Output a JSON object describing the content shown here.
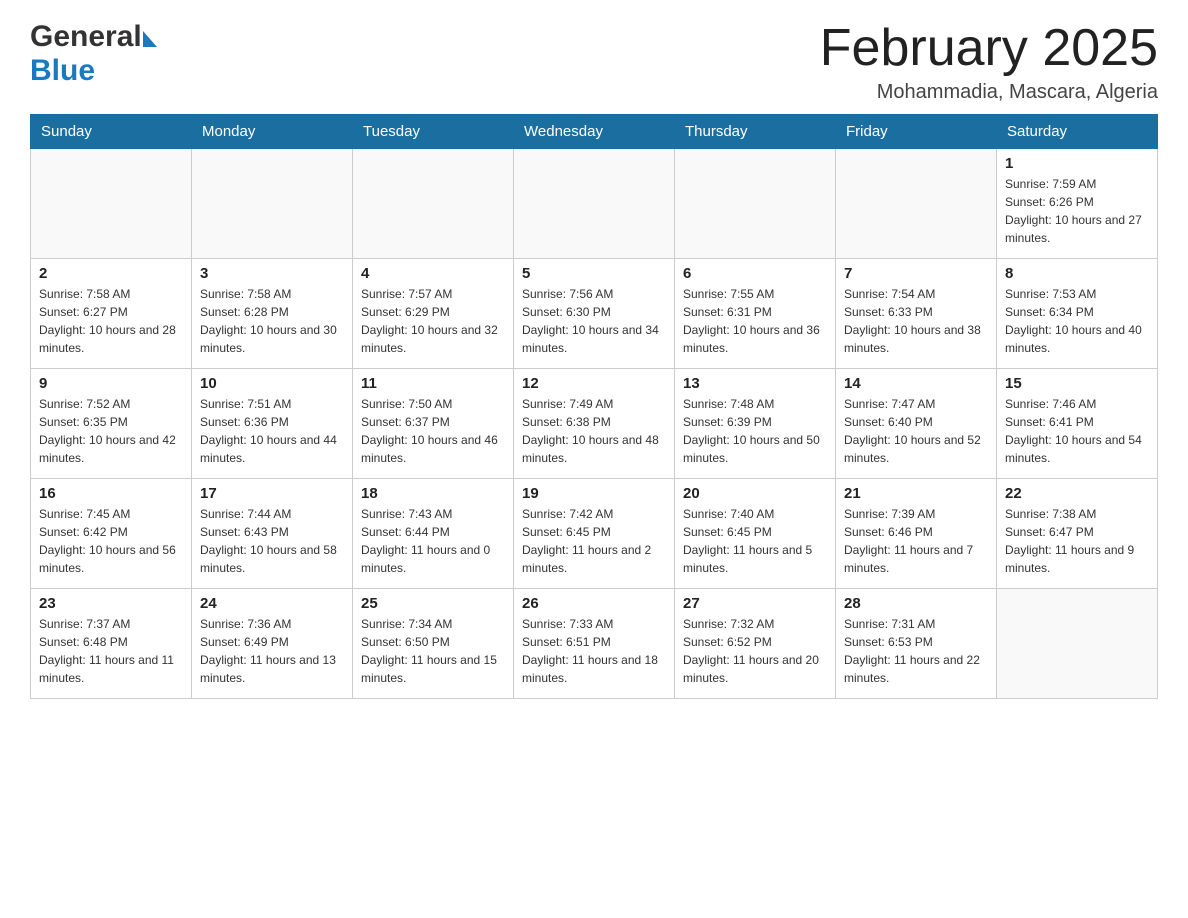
{
  "header": {
    "month_title": "February 2025",
    "location": "Mohammadia, Mascara, Algeria",
    "logo_general": "General",
    "logo_blue": "Blue"
  },
  "days_of_week": [
    "Sunday",
    "Monday",
    "Tuesday",
    "Wednesday",
    "Thursday",
    "Friday",
    "Saturday"
  ],
  "weeks": [
    [
      {
        "day": "",
        "sunrise": "",
        "sunset": "",
        "daylight": ""
      },
      {
        "day": "",
        "sunrise": "",
        "sunset": "",
        "daylight": ""
      },
      {
        "day": "",
        "sunrise": "",
        "sunset": "",
        "daylight": ""
      },
      {
        "day": "",
        "sunrise": "",
        "sunset": "",
        "daylight": ""
      },
      {
        "day": "",
        "sunrise": "",
        "sunset": "",
        "daylight": ""
      },
      {
        "day": "",
        "sunrise": "",
        "sunset": "",
        "daylight": ""
      },
      {
        "day": "1",
        "sunrise": "Sunrise: 7:59 AM",
        "sunset": "Sunset: 6:26 PM",
        "daylight": "Daylight: 10 hours and 27 minutes."
      }
    ],
    [
      {
        "day": "2",
        "sunrise": "Sunrise: 7:58 AM",
        "sunset": "Sunset: 6:27 PM",
        "daylight": "Daylight: 10 hours and 28 minutes."
      },
      {
        "day": "3",
        "sunrise": "Sunrise: 7:58 AM",
        "sunset": "Sunset: 6:28 PM",
        "daylight": "Daylight: 10 hours and 30 minutes."
      },
      {
        "day": "4",
        "sunrise": "Sunrise: 7:57 AM",
        "sunset": "Sunset: 6:29 PM",
        "daylight": "Daylight: 10 hours and 32 minutes."
      },
      {
        "day": "5",
        "sunrise": "Sunrise: 7:56 AM",
        "sunset": "Sunset: 6:30 PM",
        "daylight": "Daylight: 10 hours and 34 minutes."
      },
      {
        "day": "6",
        "sunrise": "Sunrise: 7:55 AM",
        "sunset": "Sunset: 6:31 PM",
        "daylight": "Daylight: 10 hours and 36 minutes."
      },
      {
        "day": "7",
        "sunrise": "Sunrise: 7:54 AM",
        "sunset": "Sunset: 6:33 PM",
        "daylight": "Daylight: 10 hours and 38 minutes."
      },
      {
        "day": "8",
        "sunrise": "Sunrise: 7:53 AM",
        "sunset": "Sunset: 6:34 PM",
        "daylight": "Daylight: 10 hours and 40 minutes."
      }
    ],
    [
      {
        "day": "9",
        "sunrise": "Sunrise: 7:52 AM",
        "sunset": "Sunset: 6:35 PM",
        "daylight": "Daylight: 10 hours and 42 minutes."
      },
      {
        "day": "10",
        "sunrise": "Sunrise: 7:51 AM",
        "sunset": "Sunset: 6:36 PM",
        "daylight": "Daylight: 10 hours and 44 minutes."
      },
      {
        "day": "11",
        "sunrise": "Sunrise: 7:50 AM",
        "sunset": "Sunset: 6:37 PM",
        "daylight": "Daylight: 10 hours and 46 minutes."
      },
      {
        "day": "12",
        "sunrise": "Sunrise: 7:49 AM",
        "sunset": "Sunset: 6:38 PM",
        "daylight": "Daylight: 10 hours and 48 minutes."
      },
      {
        "day": "13",
        "sunrise": "Sunrise: 7:48 AM",
        "sunset": "Sunset: 6:39 PM",
        "daylight": "Daylight: 10 hours and 50 minutes."
      },
      {
        "day": "14",
        "sunrise": "Sunrise: 7:47 AM",
        "sunset": "Sunset: 6:40 PM",
        "daylight": "Daylight: 10 hours and 52 minutes."
      },
      {
        "day": "15",
        "sunrise": "Sunrise: 7:46 AM",
        "sunset": "Sunset: 6:41 PM",
        "daylight": "Daylight: 10 hours and 54 minutes."
      }
    ],
    [
      {
        "day": "16",
        "sunrise": "Sunrise: 7:45 AM",
        "sunset": "Sunset: 6:42 PM",
        "daylight": "Daylight: 10 hours and 56 minutes."
      },
      {
        "day": "17",
        "sunrise": "Sunrise: 7:44 AM",
        "sunset": "Sunset: 6:43 PM",
        "daylight": "Daylight: 10 hours and 58 minutes."
      },
      {
        "day": "18",
        "sunrise": "Sunrise: 7:43 AM",
        "sunset": "Sunset: 6:44 PM",
        "daylight": "Daylight: 11 hours and 0 minutes."
      },
      {
        "day": "19",
        "sunrise": "Sunrise: 7:42 AM",
        "sunset": "Sunset: 6:45 PM",
        "daylight": "Daylight: 11 hours and 2 minutes."
      },
      {
        "day": "20",
        "sunrise": "Sunrise: 7:40 AM",
        "sunset": "Sunset: 6:45 PM",
        "daylight": "Daylight: 11 hours and 5 minutes."
      },
      {
        "day": "21",
        "sunrise": "Sunrise: 7:39 AM",
        "sunset": "Sunset: 6:46 PM",
        "daylight": "Daylight: 11 hours and 7 minutes."
      },
      {
        "day": "22",
        "sunrise": "Sunrise: 7:38 AM",
        "sunset": "Sunset: 6:47 PM",
        "daylight": "Daylight: 11 hours and 9 minutes."
      }
    ],
    [
      {
        "day": "23",
        "sunrise": "Sunrise: 7:37 AM",
        "sunset": "Sunset: 6:48 PM",
        "daylight": "Daylight: 11 hours and 11 minutes."
      },
      {
        "day": "24",
        "sunrise": "Sunrise: 7:36 AM",
        "sunset": "Sunset: 6:49 PM",
        "daylight": "Daylight: 11 hours and 13 minutes."
      },
      {
        "day": "25",
        "sunrise": "Sunrise: 7:34 AM",
        "sunset": "Sunset: 6:50 PM",
        "daylight": "Daylight: 11 hours and 15 minutes."
      },
      {
        "day": "26",
        "sunrise": "Sunrise: 7:33 AM",
        "sunset": "Sunset: 6:51 PM",
        "daylight": "Daylight: 11 hours and 18 minutes."
      },
      {
        "day": "27",
        "sunrise": "Sunrise: 7:32 AM",
        "sunset": "Sunset: 6:52 PM",
        "daylight": "Daylight: 11 hours and 20 minutes."
      },
      {
        "day": "28",
        "sunrise": "Sunrise: 7:31 AM",
        "sunset": "Sunset: 6:53 PM",
        "daylight": "Daylight: 11 hours and 22 minutes."
      },
      {
        "day": "",
        "sunrise": "",
        "sunset": "",
        "daylight": ""
      }
    ]
  ]
}
